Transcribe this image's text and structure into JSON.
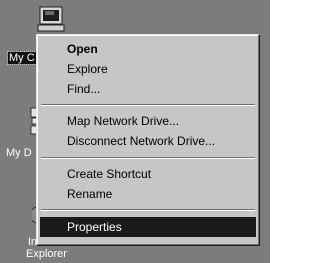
{
  "desktop": {
    "icons": [
      {
        "label": "My C"
      },
      {
        "label": "My D"
      },
      {
        "label": "Internet\nExplorer"
      }
    ]
  },
  "context_menu": {
    "items": [
      {
        "label": "Open",
        "bold": true
      },
      {
        "label": "Explore"
      },
      {
        "label": "Find..."
      },
      {
        "label": "Map Network Drive..."
      },
      {
        "label": "Disconnect Network Drive..."
      },
      {
        "label": "Create Shortcut"
      },
      {
        "label": "Rename"
      },
      {
        "label": "Properties",
        "highlighted": true
      }
    ]
  },
  "colors": {
    "desktop_bg": "#7c7c7c",
    "menu_bg": "#c6c6c6",
    "highlight_bg": "#1a1a1a"
  }
}
